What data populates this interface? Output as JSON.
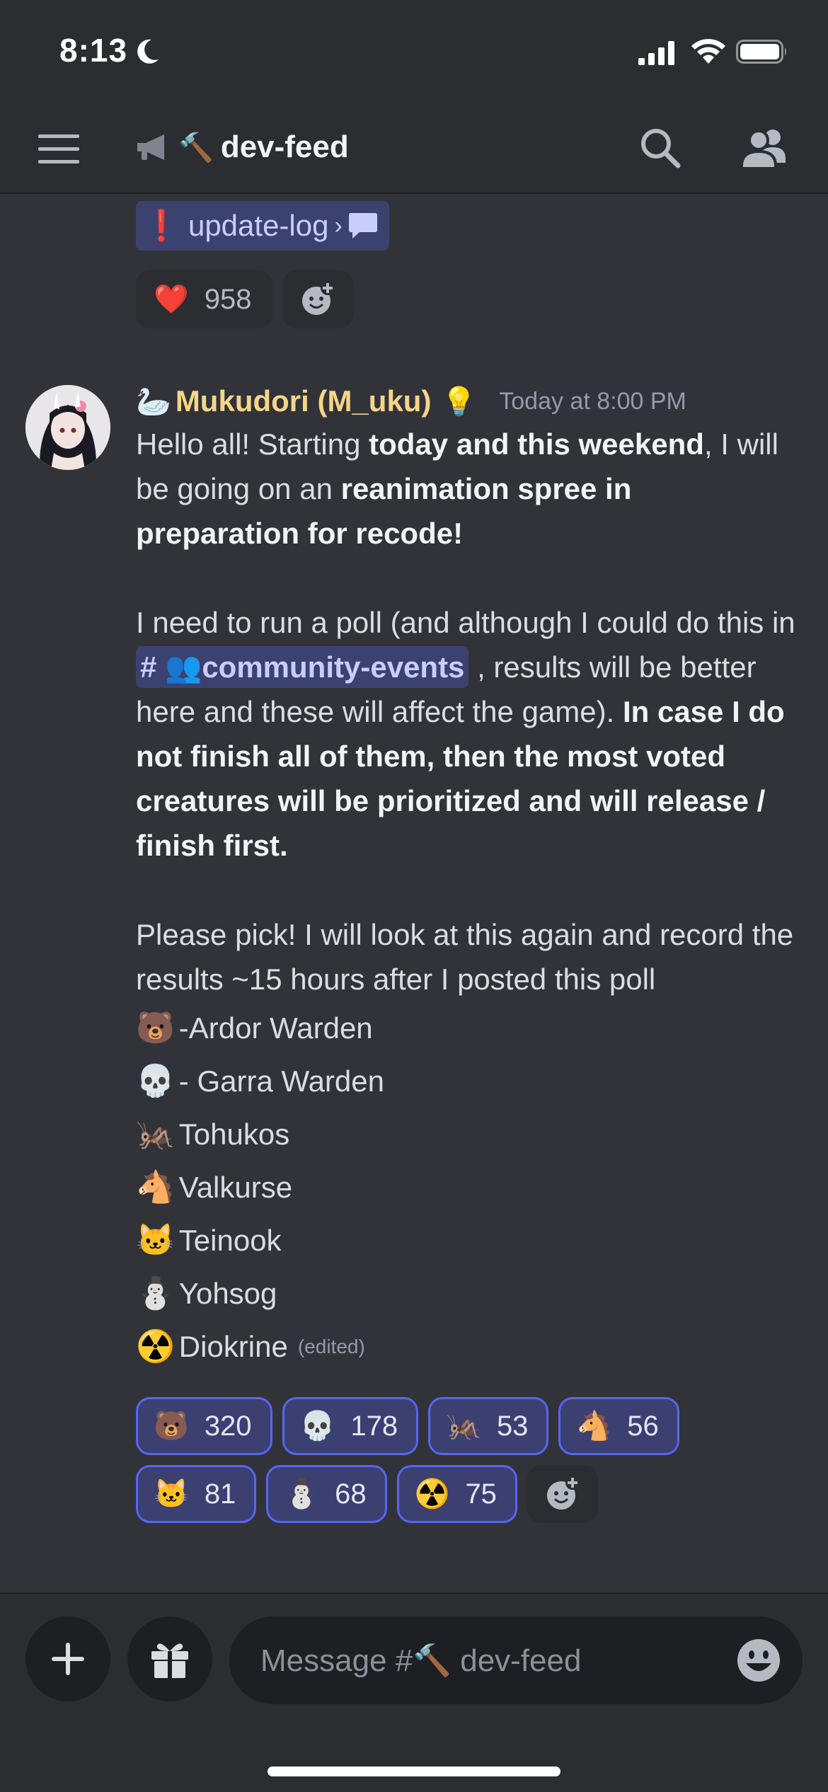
{
  "status_bar": {
    "time": "8:13"
  },
  "header": {
    "channel_prefix": "🔨",
    "channel_name": "dev-feed",
    "icons": [
      "menu-icon",
      "announcement-icon",
      "search-icon",
      "members-icon"
    ]
  },
  "previous_message": {
    "thread": {
      "label": "❗ update-log",
      "arrow": "›",
      "icon": "chat-bubble-icon"
    },
    "reactions": [
      {
        "emoji": "❤️",
        "count": "958",
        "active": false
      }
    ]
  },
  "message": {
    "author_prefix": "🦢",
    "author": "Mukudori (M_uku)",
    "author_badge": "💡",
    "timestamp": "Today at 8:00 PM",
    "p1": {
      "t1": "Hello all! Starting ",
      "b1": "today and  this weekend",
      "t2": ", I will be going on an ",
      "b2": "reanimation spree in preparation for recode!"
    },
    "p2": {
      "t1": "I need to run a poll (and although I could do this in ",
      "mention": "# 👥community-events",
      "t2": " , results will be better here and these will affect the game). ",
      "b1": "In case I do not finish all of them, then the most voted creatures will be prioritized and will release / finish first."
    },
    "p3": "Please pick! I will look at this again and record the results ~15 hours after I posted this poll",
    "options": [
      {
        "emoji": "🐻",
        "label": "-Ardor Warden"
      },
      {
        "emoji": "💀",
        "label": "- Garra Warden"
      },
      {
        "emoji": "🦗",
        "label": " Tohukos"
      },
      {
        "emoji": "🐴",
        "label": " Valkurse"
      },
      {
        "emoji": "🐱",
        "label": " Teinook"
      },
      {
        "emoji": "⛄",
        "label": "Yohsog"
      },
      {
        "emoji": "☢️",
        "label": "Diokrine"
      }
    ],
    "edited_label": "(edited)",
    "reactions": [
      {
        "emoji": "🐻",
        "count": "320",
        "active": true
      },
      {
        "emoji": "💀",
        "count": "178",
        "active": true
      },
      {
        "emoji": "🦗",
        "count": "53",
        "active": true
      },
      {
        "emoji": "🐴",
        "count": "56",
        "active": true
      },
      {
        "emoji": "🐱",
        "count": "81",
        "active": true
      },
      {
        "emoji": "⛄",
        "count": "68",
        "active": true
      },
      {
        "emoji": "☢️",
        "count": "75",
        "active": true
      }
    ]
  },
  "composer": {
    "placeholder": "Message #🔨 dev-feed",
    "icons": [
      "plus-icon",
      "gift-icon",
      "emoji-icon"
    ]
  },
  "colors": {
    "background": "#313338",
    "header": "#2b2d31",
    "accent": "#5865f2",
    "author": "#f5d58a",
    "mention_bg": "#3c4270"
  }
}
